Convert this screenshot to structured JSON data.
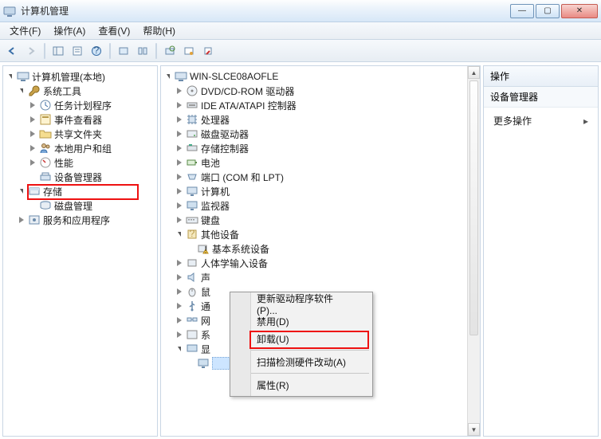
{
  "window": {
    "title": "计算机管理"
  },
  "menus": {
    "file": "文件(F)",
    "action": "操作(A)",
    "view": "查看(V)",
    "help": "帮助(H)"
  },
  "left_tree": {
    "root": "计算机管理(本地)",
    "systools": "系统工具",
    "task_scheduler": "任务计划程序",
    "event_viewer": "事件查看器",
    "shared_folders": "共享文件夹",
    "local_users": "本地用户和组",
    "perf": "性能",
    "device_manager": "设备管理器",
    "storage": "存储",
    "disk_mgmt": "磁盘管理",
    "services_apps": "服务和应用程序"
  },
  "mid_tree": {
    "host": "WIN-SLCE08AOFLE",
    "dvd": "DVD/CD-ROM 驱动器",
    "ide": "IDE ATA/ATAPI 控制器",
    "cpu": "处理器",
    "disk_drives": "磁盘驱动器",
    "storage_ctrl": "存储控制器",
    "battery": "电池",
    "ports": "端口 (COM 和 LPT)",
    "computer": "计算机",
    "monitor": "监视器",
    "keyboard": "键盘",
    "other": "其他设备",
    "base_sys": "基本系统设备",
    "hid": "人体学输入设备",
    "sound": "声",
    "mouse": "鼠",
    "usb": "通",
    "net": "网",
    "sys": "系",
    "display": "显"
  },
  "ctx": {
    "update": "更新驱动程序软件(P)...",
    "disable": "禁用(D)",
    "uninstall": "卸载(U)",
    "scan": "扫描检测硬件改动(A)",
    "props": "属性(R)"
  },
  "right": {
    "header": "操作",
    "section": "设备管理器",
    "more": "更多操作"
  }
}
